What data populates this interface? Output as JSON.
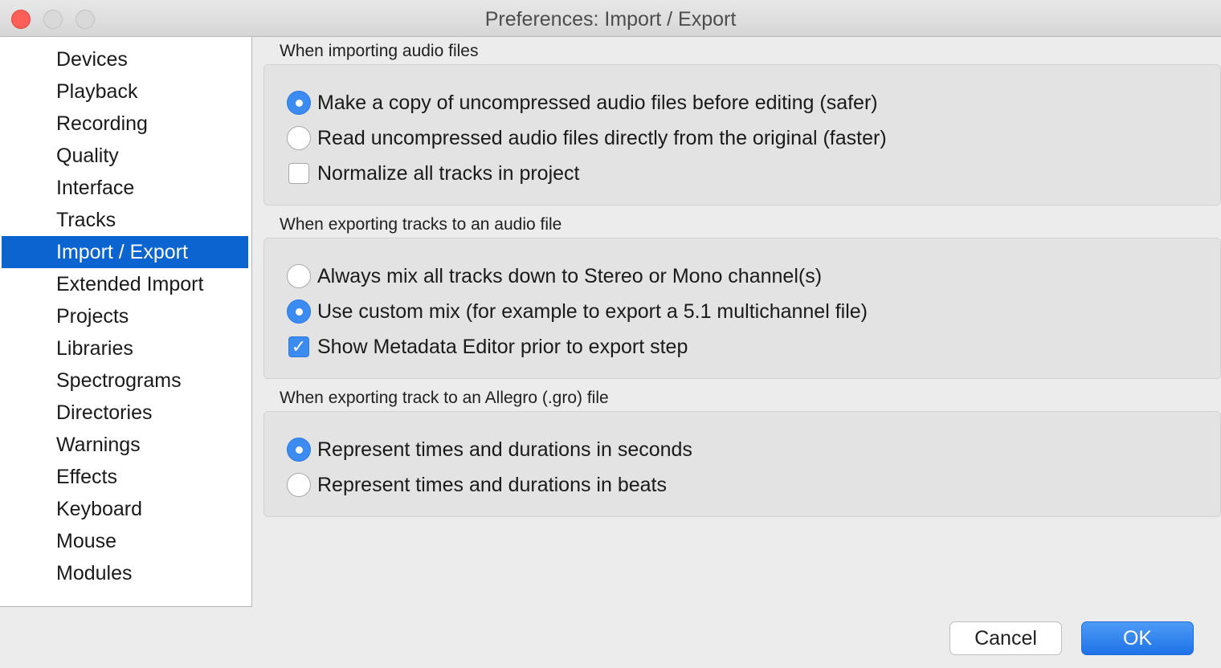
{
  "window": {
    "title": "Preferences: Import / Export"
  },
  "sidebar": {
    "items": [
      {
        "label": "Devices"
      },
      {
        "label": "Playback"
      },
      {
        "label": "Recording"
      },
      {
        "label": "Quality"
      },
      {
        "label": "Interface"
      },
      {
        "label": "Tracks"
      },
      {
        "label": "Import / Export",
        "selected": true
      },
      {
        "label": "Extended Import"
      },
      {
        "label": "Projects"
      },
      {
        "label": "Libraries"
      },
      {
        "label": "Spectrograms"
      },
      {
        "label": "Directories"
      },
      {
        "label": "Warnings"
      },
      {
        "label": "Effects"
      },
      {
        "label": "Keyboard"
      },
      {
        "label": "Mouse"
      },
      {
        "label": "Modules"
      }
    ]
  },
  "importing": {
    "heading": "When importing audio files",
    "copy_option": "Make a copy of uncompressed audio files before editing (safer)",
    "read_option": "Read uncompressed audio files directly from the original (faster)",
    "normalize_option": "Normalize all tracks in project",
    "selected": "copy",
    "normalize_checked": false
  },
  "exporting": {
    "heading": "When exporting tracks to an audio file",
    "mix_down_option": "Always mix all tracks down to Stereo or Mono channel(s)",
    "custom_mix_option": "Use custom mix (for example to export a 5.1 multichannel file)",
    "metadata_option": "Show Metadata Editor prior to export step",
    "selected": "custom_mix",
    "metadata_checked": true
  },
  "allegro": {
    "heading": "When exporting track to an Allegro (.gro) file",
    "seconds_option": "Represent times and durations in seconds",
    "beats_option": "Represent times and durations in beats",
    "selected": "seconds"
  },
  "buttons": {
    "cancel": "Cancel",
    "ok": "OK"
  },
  "colors": {
    "accent": "#3b8bf0",
    "selection": "#0b64d0"
  }
}
